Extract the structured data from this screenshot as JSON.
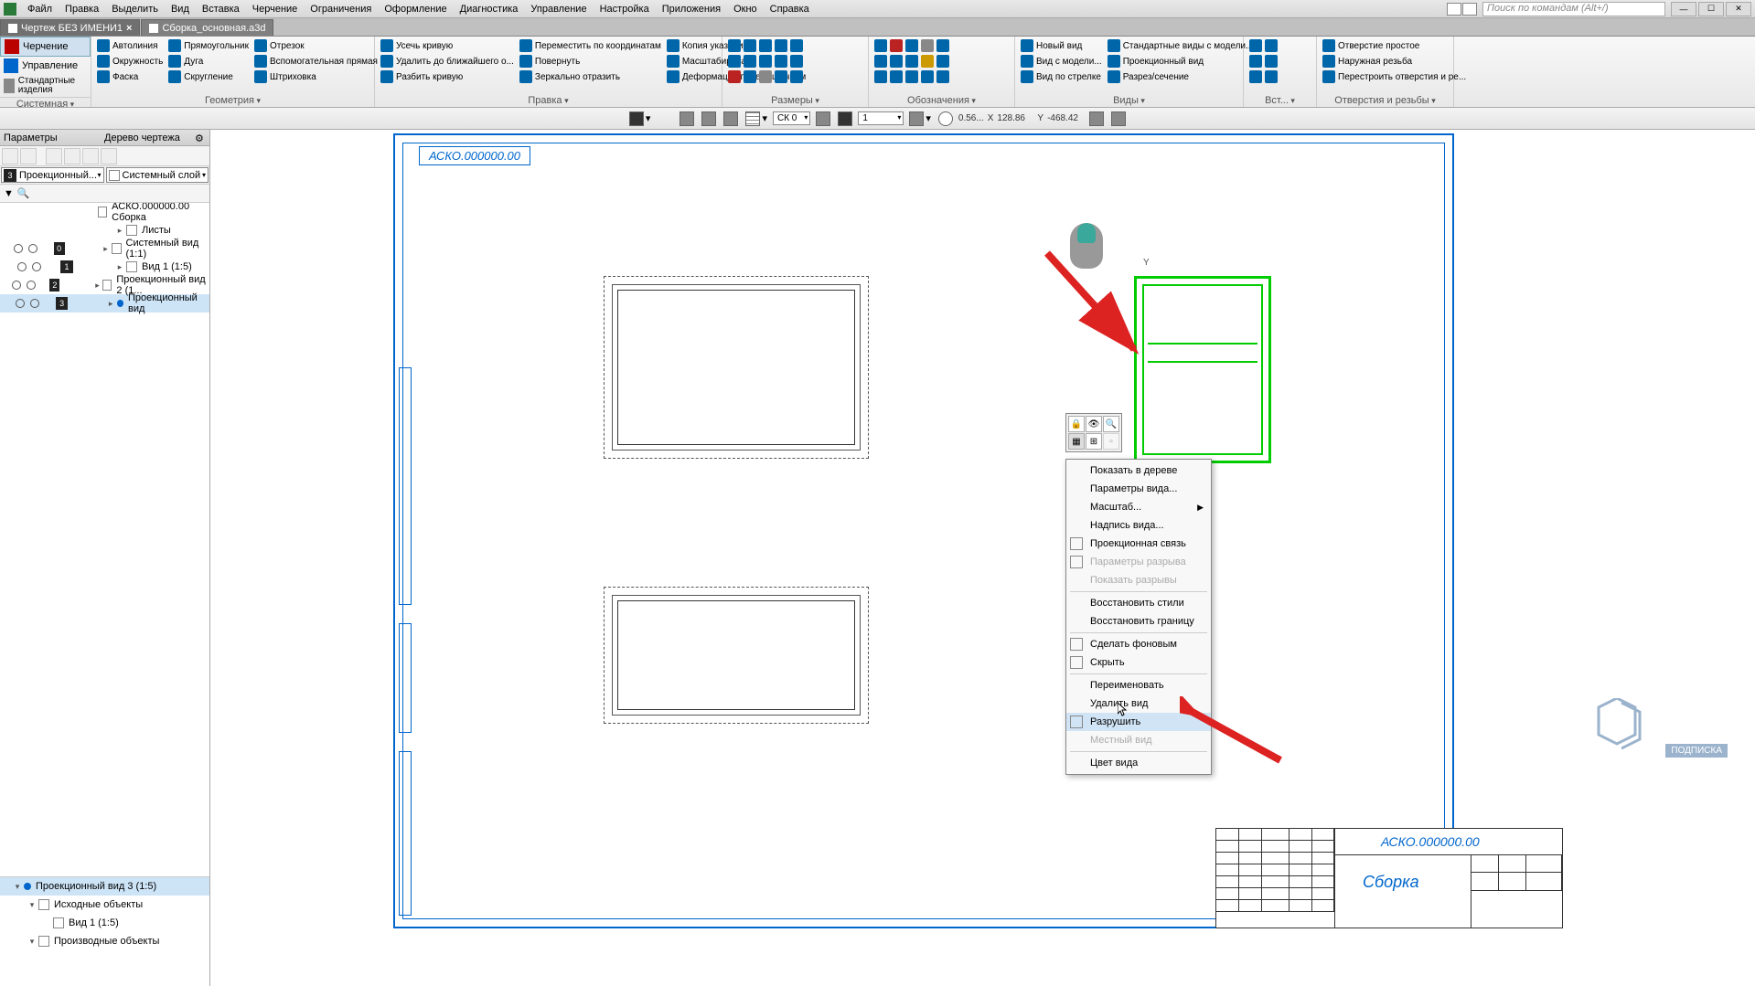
{
  "menu": [
    "Файл",
    "Правка",
    "Выделить",
    "Вид",
    "Вставка",
    "Черчение",
    "Ограничения",
    "Оформление",
    "Диагностика",
    "Управление",
    "Настройка",
    "Приложения",
    "Окно",
    "Справка"
  ],
  "search_placeholder": "Поиск по командам (Alt+/)",
  "tabs": [
    {
      "label": "Чертеж БЕЗ ИМЕНИ1",
      "active": true,
      "closable": true
    },
    {
      "label": "Сборка_основная.a3d",
      "active": false,
      "closable": false
    }
  ],
  "ribbon_left": {
    "drawing": "Черчение",
    "manage": "Управление",
    "std": "Стандартные изделия",
    "group": "Системная"
  },
  "ribbon": {
    "geometry": {
      "title": "Геометрия",
      "items": [
        "Автолиния",
        "Окружность",
        "Фаска",
        "Прямоугольник",
        "Дуга",
        "Скругление",
        "Отрезок",
        "Вспомогательная прямая",
        "Штриховка"
      ]
    },
    "edit": {
      "title": "Правка",
      "items": [
        "Усечь кривую",
        "Удалить до ближайшего о...",
        "Разбить кривую",
        "Переместить по координатам",
        "Повернуть",
        "Зеркально отразить",
        "Копия указанием",
        "Масштабировать",
        "Деформация перемещением"
      ]
    },
    "dims": {
      "title": "Размеры"
    },
    "annot": {
      "title": "Обозначения"
    },
    "constraints": {
      "title": "..."
    },
    "views": {
      "title": "Виды",
      "items": [
        "Новый вид",
        "Вид с модели...",
        "Вид по стрелке",
        "Стандартные виды с модели...",
        "Проекционный вид",
        "Разрез/сечение"
      ]
    },
    "insert": {
      "title": "Вст..."
    },
    "holes": {
      "title": "Отверстия и резьбы",
      "items": [
        "Отверстие простое",
        "Наружная резьба",
        "Перестроить отверстия и ре..."
      ]
    }
  },
  "propbar": {
    "sk": "СК 0",
    "scale": "1",
    "zoom": "0.56...",
    "x_label": "X",
    "x": "128.86",
    "y_label": "Y",
    "y": "-468.42"
  },
  "sidebar": {
    "params": "Параметры",
    "tree_title": "Дерево чертежа",
    "combo1": "Проекционный...",
    "combo1_icon": "3",
    "combo2": "Системный слой",
    "root": "АСКО.000000.00 Сборка",
    "items": [
      {
        "label": "Листы",
        "badge": null,
        "indent": 1
      },
      {
        "label": "Системный вид (1:1)",
        "badge": "0",
        "indent": 1
      },
      {
        "label": "Вид 1 (1:5)",
        "badge": "1",
        "indent": 1
      },
      {
        "label": "Проекционный вид 2 (1...",
        "badge": "2",
        "indent": 1
      },
      {
        "label": "Проекционный вид",
        "badge": "3",
        "indent": 1,
        "sel": true,
        "dot": true
      }
    ],
    "bottom": [
      {
        "label": "Проекционный вид 3 (1:5)",
        "sel": true,
        "dot": true,
        "indent": 0
      },
      {
        "label": "Исходные объекты",
        "indent": 1
      },
      {
        "label": "Вид 1 (1:5)",
        "indent": 2
      },
      {
        "label": "Производные объекты",
        "indent": 1
      }
    ]
  },
  "drawing_label": "АСКО.000000.00",
  "titleblock": {
    "code": "АСКО.000000.00",
    "name": "Сборка"
  },
  "context_menu": [
    {
      "label": "Показать в дереве"
    },
    {
      "label": "Параметры вида..."
    },
    {
      "label": "Масштаб...",
      "submenu": true
    },
    {
      "label": "Надпись вида..."
    },
    {
      "label": "Проекционная связь",
      "icon": true
    },
    {
      "label": "Параметры разрыва",
      "dis": true,
      "icon": true
    },
    {
      "label": "Показать разрывы",
      "dis": true
    },
    {
      "sep": true
    },
    {
      "label": "Восстановить стили"
    },
    {
      "label": "Восстановить границу"
    },
    {
      "sep": true
    },
    {
      "label": "Сделать фоновым",
      "icon": true
    },
    {
      "label": "Скрыть",
      "icon": true
    },
    {
      "sep": true
    },
    {
      "label": "Переименовать"
    },
    {
      "label": "Удалить вид"
    },
    {
      "label": "Разрушить",
      "sel": true,
      "icon": true
    },
    {
      "label": "Местный вид",
      "dis": true
    },
    {
      "sep": true
    },
    {
      "label": "Цвет вида"
    }
  ],
  "watermark": "ПОДПИСКА"
}
